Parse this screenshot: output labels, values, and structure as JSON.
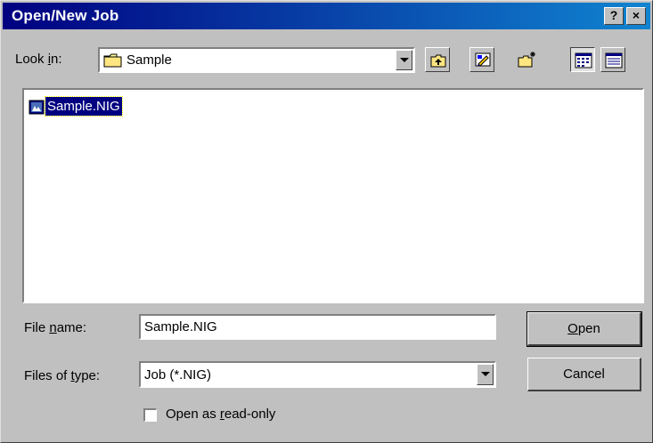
{
  "window": {
    "title": "Open/New Job",
    "help_glyph": "?",
    "close_glyph": "×"
  },
  "look_in": {
    "label_pre": "Look ",
    "label_key": "i",
    "label_post": "n:",
    "value": "Sample",
    "icon": "folder-icon"
  },
  "toolbar": {
    "buttons": [
      "up-one-level-icon",
      "desktop-icon",
      "new-folder-icon",
      "list-view-icon",
      "details-view-icon"
    ]
  },
  "file_list": {
    "items": [
      {
        "name": "Sample.NIG",
        "icon": "job-file-icon",
        "selected": true
      }
    ]
  },
  "file_name": {
    "label_pre": "File ",
    "label_key": "n",
    "label_post": "ame:",
    "value": "Sample.NIG"
  },
  "file_type": {
    "label_pre": "Files of ",
    "label_key": "t",
    "label_post": "ype:",
    "value": "Job (*.NIG)"
  },
  "buttons": {
    "open_key": "O",
    "open_rest": "pen",
    "cancel": "Cancel"
  },
  "read_only": {
    "label_pre": "Open as ",
    "label_key": "r",
    "label_post": "ead-only",
    "checked": false
  },
  "colors": {
    "title_start": "#000080",
    "title_end": "#1084d0",
    "face": "#c0c0c0",
    "selection": "#000080"
  }
}
